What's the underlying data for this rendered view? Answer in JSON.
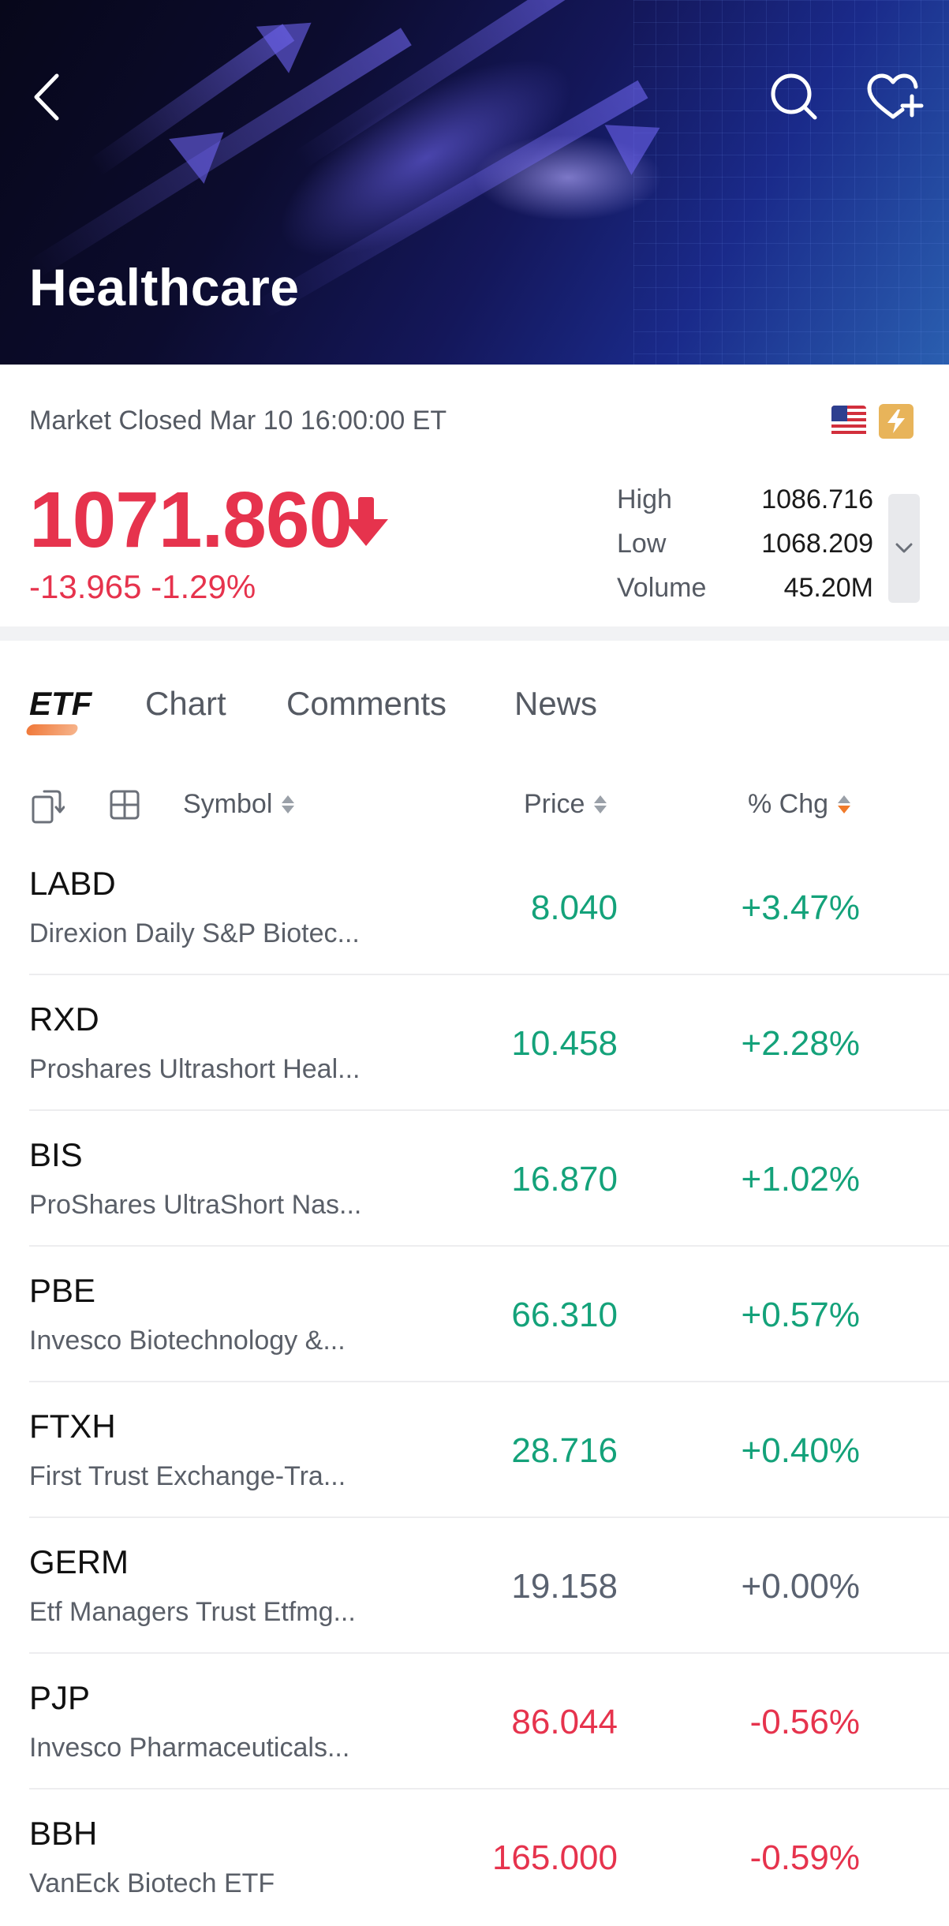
{
  "header": {
    "title": "Healthcare",
    "back_icon": "back-chevron-icon",
    "search_icon": "search-icon",
    "watchlist_icon": "heart-plus-icon"
  },
  "market": {
    "status": "Market Closed Mar 10 16:00:00 ET",
    "flag_icon": "us-flag-icon",
    "bolt_icon": "lightning-icon",
    "price": "1071.860",
    "change": "-13.965  -1.29%",
    "stats": [
      {
        "label": "High",
        "value": "1086.716"
      },
      {
        "label": "Low",
        "value": "1068.209"
      },
      {
        "label": "Volume",
        "value": "45.20M"
      }
    ],
    "colors": {
      "down": "#e6334d",
      "up": "#14a27a",
      "neutral": "#5a6270",
      "accent": "#f07a2a"
    }
  },
  "tabs": [
    {
      "label": "ETF",
      "active": true
    },
    {
      "label": "Chart",
      "active": false
    },
    {
      "label": "Comments",
      "active": false
    },
    {
      "label": "News",
      "active": false
    }
  ],
  "columns": {
    "symbol": "Symbol",
    "price": "Price",
    "chg": "% Chg"
  },
  "rows": [
    {
      "symbol": "LABD",
      "name": "Direxion Daily S&P Biotec...",
      "price": "8.040",
      "chg": "+3.47%",
      "dir": "up"
    },
    {
      "symbol": "RXD",
      "name": "Proshares Ultrashort Heal...",
      "price": "10.458",
      "chg": "+2.28%",
      "dir": "up"
    },
    {
      "symbol": "BIS",
      "name": "ProShares UltraShort Nas...",
      "price": "16.870",
      "chg": "+1.02%",
      "dir": "up"
    },
    {
      "symbol": "PBE",
      "name": "Invesco Biotechnology &...",
      "price": "66.310",
      "chg": "+0.57%",
      "dir": "up"
    },
    {
      "symbol": "FTXH",
      "name": "First Trust Exchange-Tra...",
      "price": "28.716",
      "chg": "+0.40%",
      "dir": "up"
    },
    {
      "symbol": "GERM",
      "name": "Etf Managers Trust Etfmg...",
      "price": "19.158",
      "chg": "+0.00%",
      "dir": "flat"
    },
    {
      "symbol": "PJP",
      "name": "Invesco Pharmaceuticals...",
      "price": "86.044",
      "chg": "-0.56%",
      "dir": "down"
    },
    {
      "symbol": "BBH",
      "name": "VanEck Biotech ETF",
      "price": "165.000",
      "chg": "-0.59%",
      "dir": "down"
    }
  ]
}
